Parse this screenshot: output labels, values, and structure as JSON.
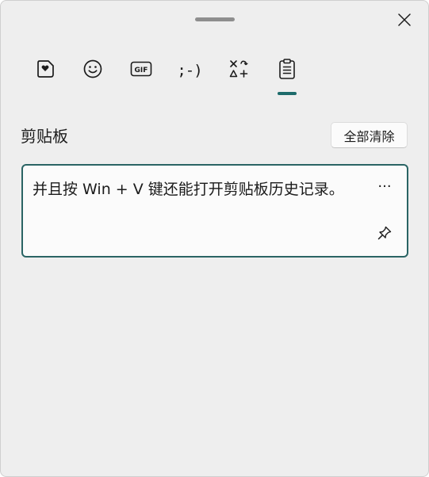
{
  "tabs": [
    {
      "name": "stickers",
      "icon": "heart-sticker-icon"
    },
    {
      "name": "emoji",
      "icon": "smiley-icon"
    },
    {
      "name": "gif",
      "icon": "gif-icon",
      "label": "GIF"
    },
    {
      "name": "kaomoji",
      "icon": "kaomoji-icon",
      "label": ";-)"
    },
    {
      "name": "symbols",
      "icon": "symbols-icon"
    },
    {
      "name": "clipboard",
      "icon": "clipboard-icon",
      "selected": true
    }
  ],
  "section": {
    "title": "剪贴板",
    "clear_all_label": "全部清除"
  },
  "clipboard_items": [
    {
      "text": "并且按 Win + V 键还能打开剪贴板历史记录。",
      "more_label": "···",
      "pinned": false
    }
  ],
  "colors": {
    "accent": "#1d6b6b",
    "card_border": "#2a6464",
    "background": "#eeeeee"
  }
}
